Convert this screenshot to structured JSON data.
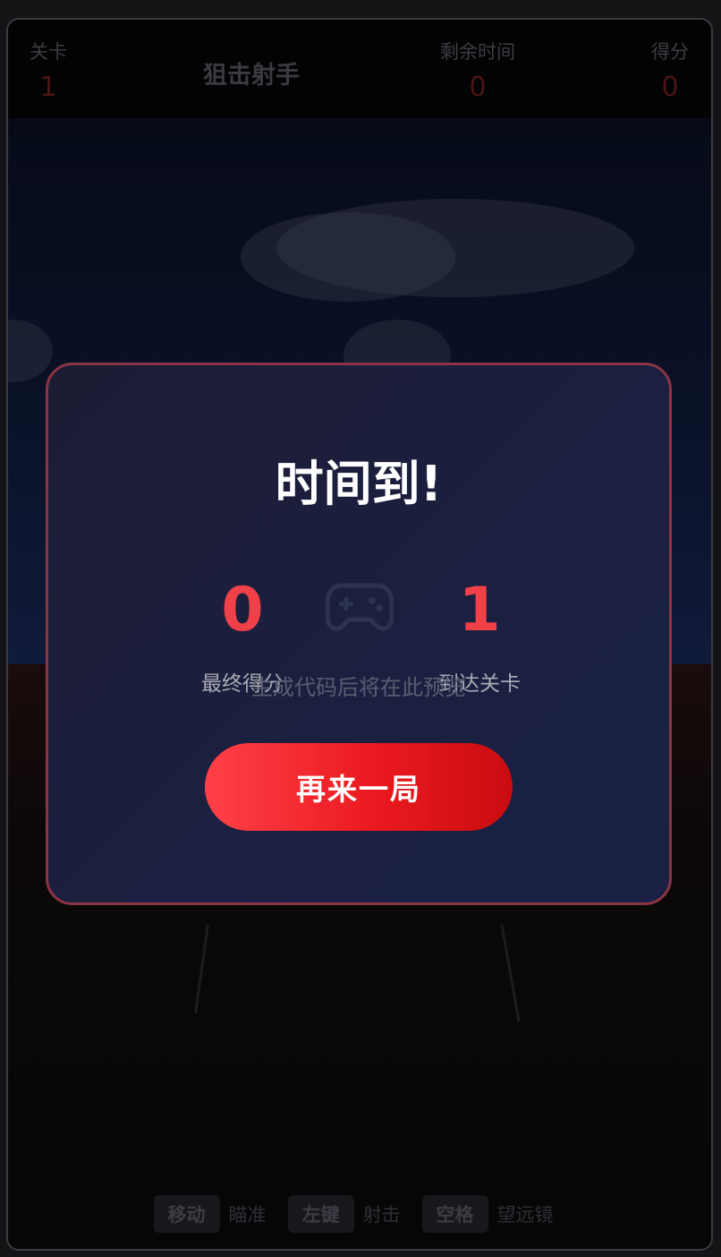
{
  "hud": {
    "level_label": "关卡",
    "level_value": "1",
    "title": "狙击射手",
    "time_label": "剩余时间",
    "time_value": "0",
    "score_label": "得分",
    "score_value": "0"
  },
  "controls": [
    {
      "key": "移动",
      "action": "瞄准"
    },
    {
      "key": "左键",
      "action": "射击"
    },
    {
      "key": "空格",
      "action": "望远镜"
    }
  ],
  "game_over": {
    "title": "时间到!",
    "final_score_value": "0",
    "final_score_label": "最终得分",
    "level_reached_value": "1",
    "level_reached_label": "到达关卡",
    "preview_hint": "生成代码后将在此预览",
    "replay_button": "再来一局"
  },
  "icons": {
    "center": "gamepad-icon"
  },
  "colors": {
    "accent_red": "#f04048",
    "overlay_bg": "#1b2040",
    "overlay_border": "#8a3444",
    "button_gradient_start": "#ff4048",
    "button_gradient_end": "#c90c10"
  }
}
